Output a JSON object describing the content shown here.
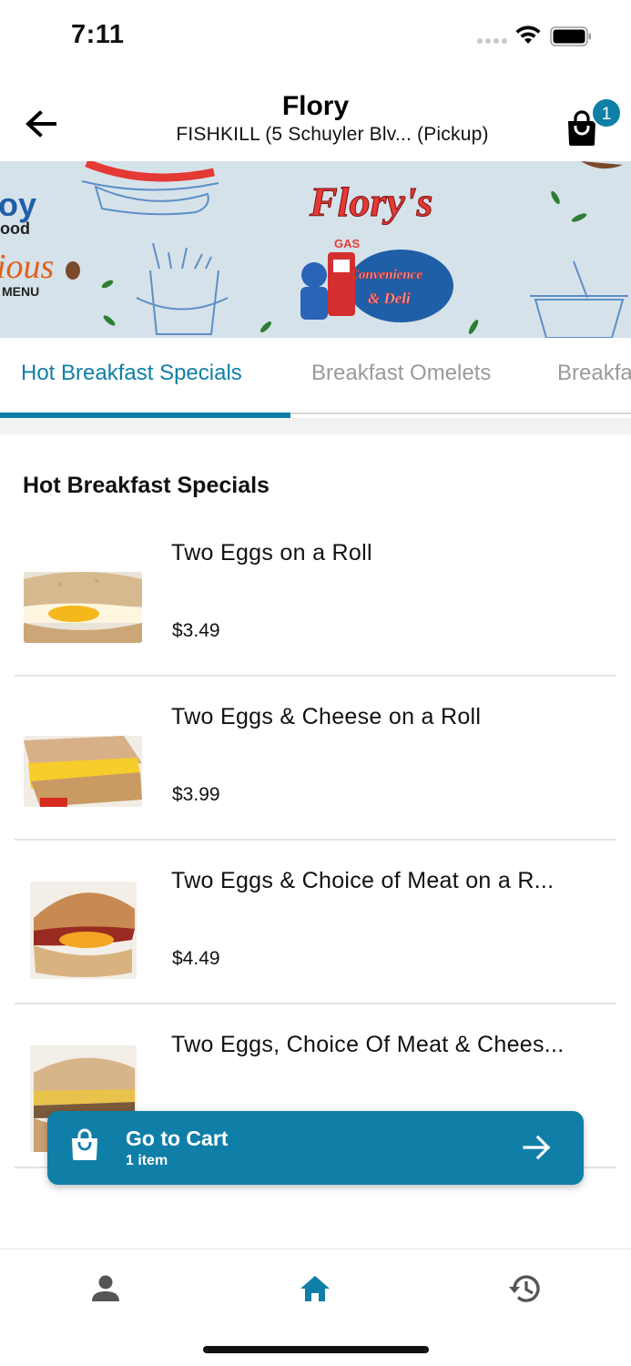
{
  "status_bar": {
    "time": "7:11"
  },
  "header": {
    "title": "Flory",
    "subtitle": "FISHKILL (5 Schuyler Blv...  (Pickup)",
    "cart_count": "1"
  },
  "banner": {
    "logo_text": "Flory's",
    "gas_text": "GAS",
    "convenience_text": "Convenience",
    "deli_text": "& Deli",
    "left_text_1": "oy",
    "left_text_2": "ood",
    "left_text_3": "ious",
    "left_text_4": "MENU"
  },
  "tabs": [
    {
      "label": "Hot Breakfast Specials",
      "active": true
    },
    {
      "label": "Breakfast Omelets",
      "active": false
    },
    {
      "label": "Breakfa",
      "active": false
    }
  ],
  "section": {
    "title": "Hot Breakfast Specials"
  },
  "items": [
    {
      "name": "Two Eggs on a Roll",
      "price": "$3.49"
    },
    {
      "name": "Two Eggs & Cheese on a Roll",
      "price": "$3.99"
    },
    {
      "name": "Two Eggs & Choice of Meat on a R...",
      "price": "$4.49"
    },
    {
      "name": "Two Eggs, Choice Of Meat & Chees...",
      "price": ""
    }
  ],
  "cart_bar": {
    "label": "Go to Cart",
    "count_text": "1 item"
  },
  "bottom_nav": [
    {
      "icon": "person-icon",
      "active": false
    },
    {
      "icon": "home-icon",
      "active": true
    },
    {
      "icon": "history-icon",
      "active": false
    }
  ],
  "colors": {
    "accent": "#0f7fa8",
    "inactive_tab": "#9a9a9a",
    "nav_icon": "#555555"
  }
}
